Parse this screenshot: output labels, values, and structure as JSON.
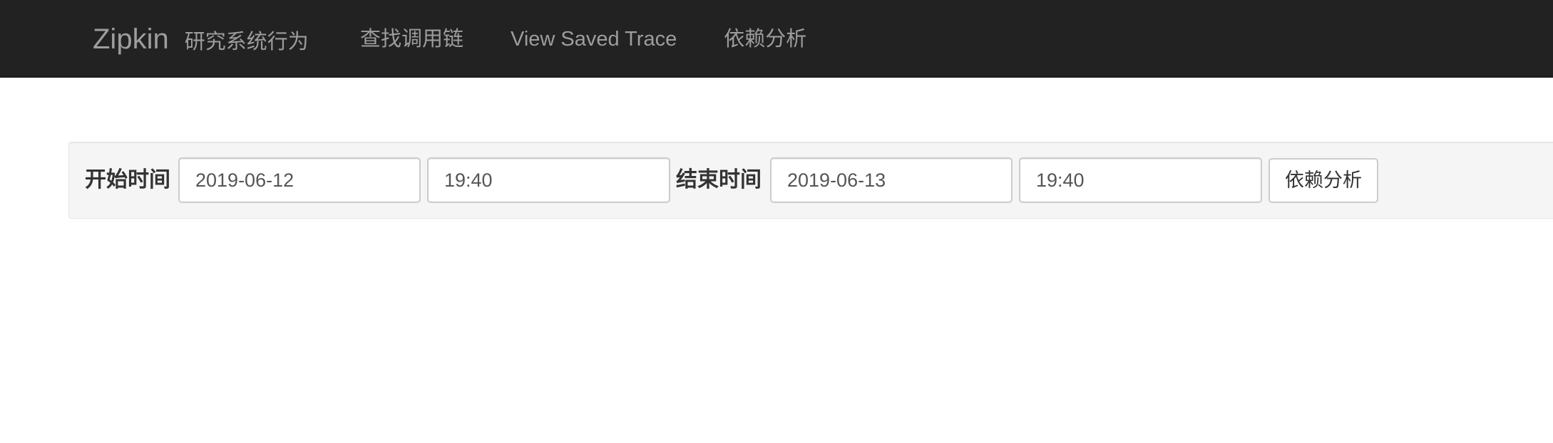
{
  "navbar": {
    "brand": "Zipkin",
    "tagline": "研究系统行为",
    "links": [
      "查找调用链",
      "View Saved Trace",
      "依赖分析"
    ]
  },
  "filter": {
    "start_label": "开始时间",
    "start_date": "2019-06-12",
    "start_time": "19:40",
    "end_label": "结束时间",
    "end_date": "2019-06-13",
    "end_time": "19:40",
    "submit_label": "依赖分析"
  },
  "colors": {
    "navbar_bg": "#222222",
    "navbar_text": "#9d9d9d",
    "well_bg": "#f5f5f5"
  }
}
